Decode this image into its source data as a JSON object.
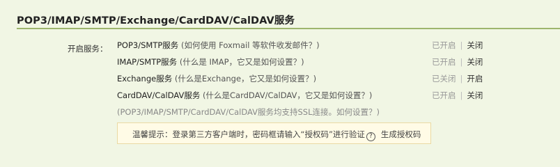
{
  "section": {
    "title": "POP3/IMAP/SMTP/Exchange/CardDAV/CalDAV服务"
  },
  "services": {
    "label": "开启服务：",
    "items": [
      {
        "name": "POP3/SMTP服务",
        "paren_open": " (",
        "help": "如何使用 Foxmail 等软件收发邮件？",
        "paren_close": ")",
        "status": "已开启",
        "separator": "|",
        "action": "关闭"
      },
      {
        "name": "IMAP/SMTP服务",
        "paren_open": " (",
        "help": "什么是 IMAP，它又是如何设置？",
        "paren_close": ")",
        "status": "已开启",
        "separator": "|",
        "action": "关闭"
      },
      {
        "name": "Exchange服务",
        "paren_open": " (",
        "help": "什么是Exchange，它又是如何设置？",
        "paren_close": ")",
        "status": "已关闭",
        "separator": "|",
        "action": "开启"
      },
      {
        "name": "CardDAV/CalDAV服务",
        "paren_open": " (",
        "help": "什么是CardDAV/CalDAV，它又是如何设置？",
        "paren_close": ")",
        "status": "已开启",
        "separator": "|",
        "action": "关闭"
      }
    ],
    "ssl_note": "(POP3/IMAP/SMTP/CardDAV/CalDAV服务均支持SSL连接。",
    "ssl_link": "如何设置？",
    "ssl_close": ")"
  },
  "tip": {
    "text": "温馨提示：登录第三方客户端时，密码框请输入“授权码”进行验证",
    "help_icon_glyph": "?",
    "action": "生成授权码"
  },
  "colors": {
    "background": "#f1f6e4",
    "rule": "#9db56c",
    "tip_bg": "#fffbe6",
    "tip_border": "#ead9a3"
  }
}
